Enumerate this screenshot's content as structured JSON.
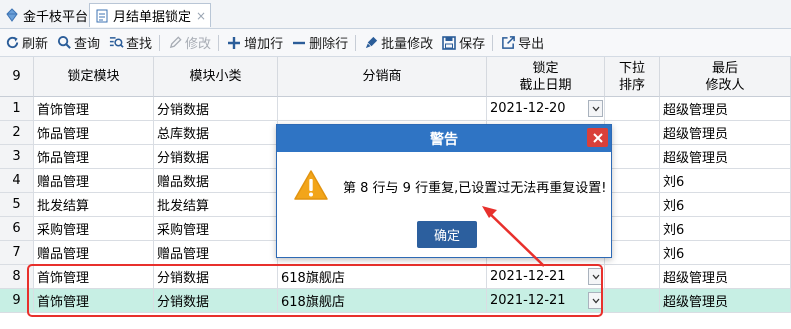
{
  "tabs": {
    "home_label": "金千枝平台",
    "active_label": "月结单据锁定",
    "close_glyph": "×"
  },
  "toolbar": {
    "refresh": "刷新",
    "query": "查询",
    "find": "查找",
    "edit": "修改",
    "add_row": "增加行",
    "delete_row": "删除行",
    "batch_edit": "批量修改",
    "save": "保存",
    "export": "导出"
  },
  "grid": {
    "headers": {
      "num": "9",
      "module": "锁定模块",
      "subtype": "模块小类",
      "distributor": "分销商",
      "date_line1": "锁定",
      "date_line2": "截止日期",
      "sort_line1": "下拉",
      "sort_line2": "排序",
      "editor_line1": "最后",
      "editor_line2": "修改人"
    },
    "rows": [
      {
        "num": "1",
        "module": "首饰管理",
        "subtype": "分销数据",
        "distributor": "",
        "date": "2021-12-20",
        "editor": "超级管理员"
      },
      {
        "num": "2",
        "module": "饰品管理",
        "subtype": "总库数据",
        "distributor": "",
        "date": "",
        "editor": "超级管理员"
      },
      {
        "num": "3",
        "module": "饰品管理",
        "subtype": "分销数据",
        "distributor": "",
        "date": "",
        "editor": "超级管理员"
      },
      {
        "num": "4",
        "module": "赠品管理",
        "subtype": "赠品数据",
        "distributor": "",
        "date": "",
        "editor": "刘6"
      },
      {
        "num": "5",
        "module": "批发结算",
        "subtype": "批发结算",
        "distributor": "",
        "date": "",
        "editor": "刘6"
      },
      {
        "num": "6",
        "module": "采购管理",
        "subtype": "采购管理",
        "distributor": "",
        "date": "",
        "editor": "刘6"
      },
      {
        "num": "7",
        "module": "赠品管理",
        "subtype": "赠品管理",
        "distributor": "",
        "date": "",
        "editor": "刘6"
      },
      {
        "num": "8",
        "module": "首饰管理",
        "subtype": "分销数据",
        "distributor": "618旗舰店",
        "date": "2021-12-21",
        "editor": "超级管理员"
      },
      {
        "num": "9",
        "module": "首饰管理",
        "subtype": "分销数据",
        "distributor": "618旗舰店",
        "date": "2021-12-21",
        "editor": "超级管理员"
      }
    ],
    "selected_row": "9"
  },
  "dialog": {
    "title": "警告",
    "message": "第 8 行与 9 行重复,已设置过无法再重复设置!",
    "ok": "确定"
  },
  "icons": {
    "tab_home": "diamond-icon",
    "tab_active": "document-icon",
    "refresh": "refresh-icon",
    "query": "search-icon",
    "find": "find-icon",
    "edit": "pencil-icon",
    "add_row": "plus-icon",
    "delete_row": "minus-icon",
    "batch_edit": "brush-icon",
    "save": "save-icon",
    "export": "export-icon",
    "warning": "warning-icon",
    "dropdown": "chevron-down-icon"
  },
  "colors": {
    "accent": "#2f74c4",
    "selected_row": "#c7efe4",
    "highlight": "#e8302c",
    "dialog_button": "#2c5f9e",
    "close_button": "#d9403a",
    "warning": "#f2a51a"
  }
}
